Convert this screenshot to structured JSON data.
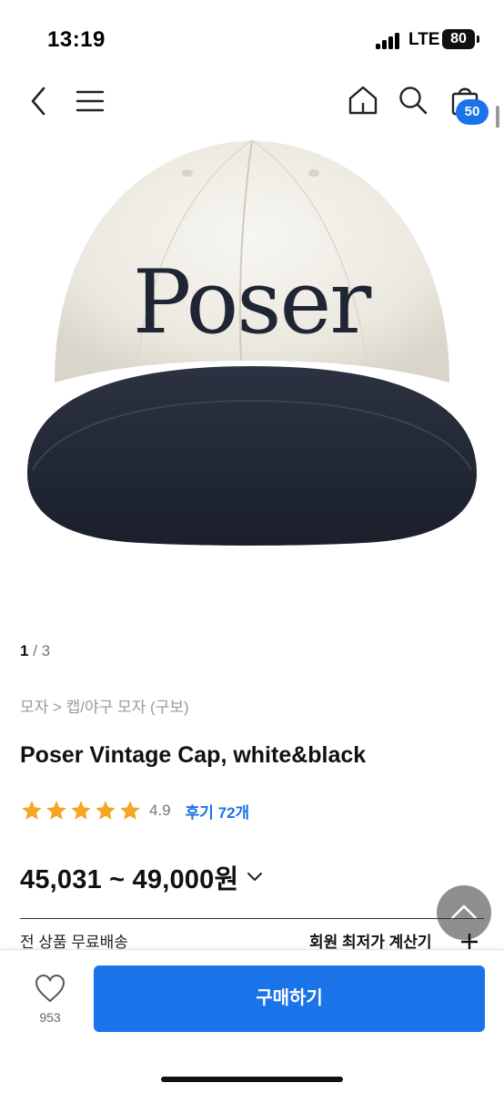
{
  "status_bar": {
    "time": "13:19",
    "network": "LTE",
    "battery": "80"
  },
  "nav": {
    "icons": [
      "back-icon",
      "menu-icon",
      "home-icon",
      "search-icon",
      "cart-icon"
    ],
    "cart_count": "50"
  },
  "product": {
    "image": {
      "current": "1",
      "separator": " / ",
      "total": "3",
      "cap_text": "Poser"
    },
    "breadcrumb": "모자 > 캡/야구 모자 (구보)",
    "title": "Poser Vintage Cap, white&black",
    "rating": {
      "stars": 5,
      "value": "4.9",
      "review_label": "후기 72개"
    },
    "price": "45,031 ~ 49,000원"
  },
  "info_row": {
    "shipping": "전 상품 무료배송",
    "member_price": "회원 최저가 계산기"
  },
  "bottom_bar": {
    "like_count": "953",
    "buy_label": "구매하기"
  },
  "colors": {
    "accent": "#1a73e8",
    "star": "#f5a623",
    "cap_crown": "#f0eee7",
    "cap_brim": "#1f2533"
  }
}
